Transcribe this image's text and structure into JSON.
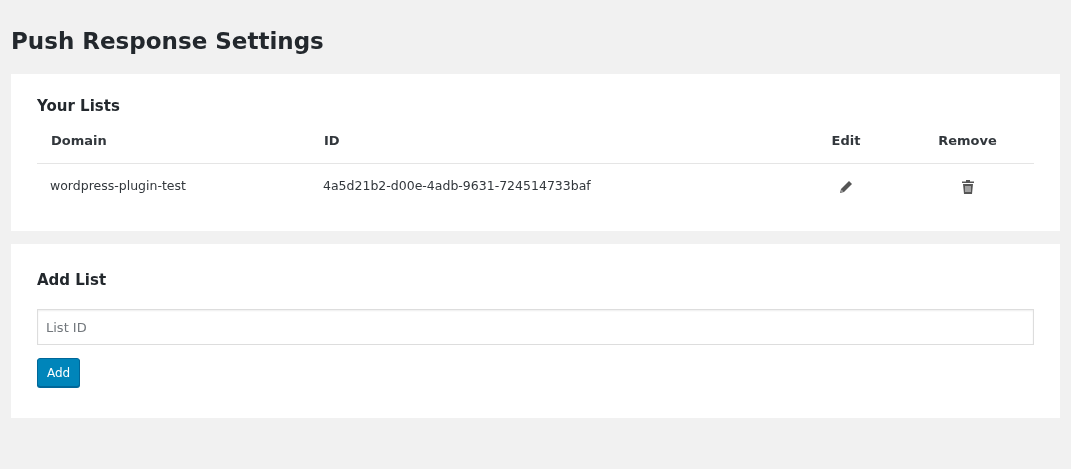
{
  "page": {
    "title": "Push Response Settings"
  },
  "lists_card": {
    "heading": "Your Lists",
    "columns": [
      "Domain",
      "ID",
      "Edit",
      "Remove"
    ],
    "rows": [
      {
        "domain": "wordpress-plugin-test",
        "id": "4a5d21b2-d00e-4adb-9631-724514733baf"
      }
    ]
  },
  "add_card": {
    "heading": "Add List",
    "field": {
      "placeholder": "List ID"
    },
    "button": "Add"
  }
}
